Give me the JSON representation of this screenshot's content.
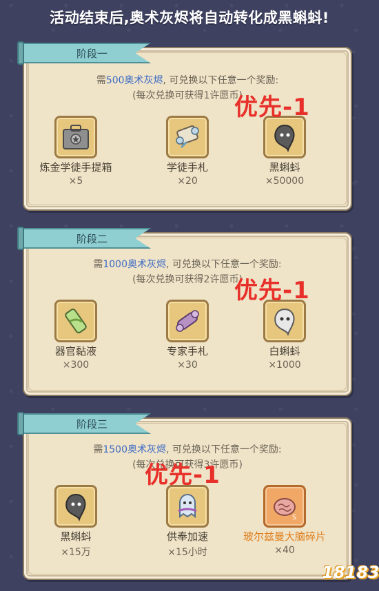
{
  "banner": "活动结束后,奥术灰烬将自动转化成黑蝌蚪!",
  "stages": [
    {
      "tab": "阶段一",
      "req_prefix": "需",
      "amount": "500奥术灰烬",
      "req_suffix": ", 可兑换以下任意一个奖励:",
      "note": "(每次兑换可获得1许愿币)",
      "priority": "优先-1",
      "rewards": [
        {
          "name": "炼金学徒手提箱",
          "qty": "×5",
          "icon": "suitcase-icon"
        },
        {
          "name": "学徒手札",
          "qty": "×20",
          "icon": "scroll-icon"
        },
        {
          "name": "黑蝌蚪",
          "qty": "×50000",
          "icon": "black-tadpole-icon"
        }
      ]
    },
    {
      "tab": "阶段二",
      "req_prefix": "需",
      "amount": "1000奥术灰烬",
      "req_suffix": ", 可兑换以下任意一个奖励:",
      "note": "(每次兑换可获得2许愿币)",
      "priority": "优先-1",
      "rewards": [
        {
          "name": "器官黏液",
          "qty": "×300",
          "icon": "slime-vial-icon"
        },
        {
          "name": "专家手札",
          "qty": "×30",
          "icon": "purple-scroll-icon"
        },
        {
          "name": "白蝌蚪",
          "qty": "×1000",
          "icon": "white-tadpole-icon"
        }
      ]
    },
    {
      "tab": "阶段三",
      "req_prefix": "需",
      "amount": "1500奥术灰烬",
      "req_suffix": ", 可兑换以下任意一个奖励:",
      "note": "(每次兑换可获得3许愿币)",
      "priority": "优先-1",
      "rewards": [
        {
          "name": "黑蝌蚪",
          "qty": "×15万",
          "icon": "black-tadpole-icon"
        },
        {
          "name": "供奉加速",
          "qty": "×15小时",
          "icon": "ghost-speedup-icon"
        },
        {
          "name": "玻尔兹曼大脑碎片",
          "qty": "×40",
          "icon": "brain-fragment-icon"
        }
      ]
    }
  ],
  "watermark": "18183"
}
